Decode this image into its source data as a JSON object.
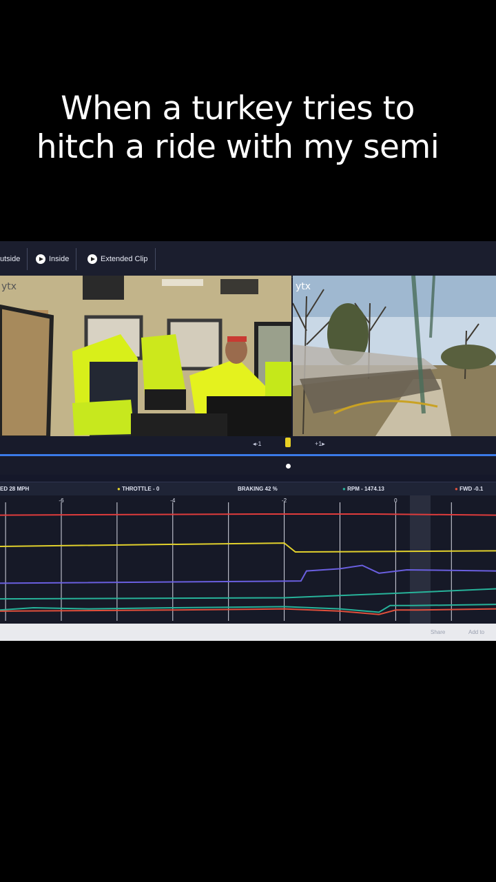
{
  "caption": {
    "line1": "When a turkey tries to",
    "line2": "hitch a ride with my semi"
  },
  "tabs": [
    {
      "label": "utside"
    },
    {
      "label": "Inside"
    },
    {
      "label": "Extended Clip"
    }
  ],
  "camera": {
    "inside_logo": "ytx",
    "outside_logo": "ytx"
  },
  "scrubber": {
    "back_label": "◂-1",
    "fwd_label": "+1▸"
  },
  "telemetry": {
    "speed": "ED 28 MPH",
    "throttle": "THROTTLE - 0",
    "braking": "BRAKING 42 %",
    "rpm": "RPM - 1474.13",
    "fwd": "FWD -0.1"
  },
  "footer": {
    "link1": "Share",
    "link2": "Add to"
  },
  "colors": {
    "speed": "#e03c3c",
    "throttle": "#e2d12c",
    "braking": "#6a5fe0",
    "rpm": "#27b39a",
    "fwd": "#e0503c"
  },
  "chart_data": {
    "type": "line",
    "x_ticks": [
      -6,
      -4,
      -2,
      0
    ],
    "xlim": [
      -7.1,
      1.8
    ],
    "ylim": [
      0,
      1
    ],
    "series": [
      {
        "x": [
          -7.1,
          -2.4,
          -0.4,
          1.8
        ],
        "y": [
          0.91,
          0.92,
          0.92,
          0.91
        ]
      },
      {
        "x": [
          -7.1,
          -2.0,
          -1.8,
          1.8
        ],
        "y": [
          0.63,
          0.66,
          0.58,
          0.59
        ]
      },
      {
        "x": [
          -7.1,
          -1.7,
          -1.6,
          -1.0,
          -0.6,
          -0.3,
          0.2,
          1.8
        ],
        "y": [
          0.3,
          0.32,
          0.41,
          0.43,
          0.46,
          0.39,
          0.42,
          0.41
        ]
      },
      {
        "x": [
          -7.1,
          -2.0,
          0.0,
          1.8
        ],
        "y": [
          0.16,
          0.17,
          0.21,
          0.25
        ]
      },
      {
        "x": [
          -7.1,
          -6.5,
          -5.5,
          -4.0,
          -2.0,
          -1.0,
          -0.3,
          -0.1,
          0.3,
          1.8
        ],
        "y": [
          0.06,
          0.08,
          0.07,
          0.08,
          0.09,
          0.07,
          0.04,
          0.1,
          0.1,
          0.11
        ]
      },
      {
        "x": [
          -7.1,
          -4.0,
          -2.0,
          -1.0,
          -0.3,
          0.0,
          0.4,
          1.8
        ],
        "y": [
          0.05,
          0.06,
          0.07,
          0.05,
          0.02,
          0.06,
          0.06,
          0.07
        ]
      }
    ]
  }
}
